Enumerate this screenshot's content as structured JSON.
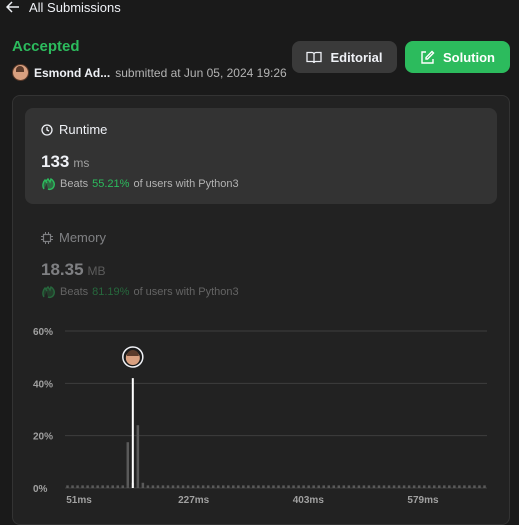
{
  "nav": {
    "back_label": "All Submissions"
  },
  "submission": {
    "status": "Accepted",
    "user": "Esmond Ad...",
    "submitted_text": "submitted at Jun 05, 2024 19:26"
  },
  "buttons": {
    "editorial": "Editorial",
    "solution": "Solution"
  },
  "runtime": {
    "title": "Runtime",
    "value": "133",
    "unit": "ms",
    "beats_label": "Beats",
    "beats_pct": "55.21%",
    "beats_suffix": "of users with Python3"
  },
  "memory": {
    "title": "Memory",
    "value": "18.35",
    "unit": "MB",
    "beats_label": "Beats",
    "beats_pct": "81.19%",
    "beats_suffix": "of users with Python3"
  },
  "colors": {
    "accent": "#2cbb5d",
    "background": "#1a1a1a",
    "panel": "#333333"
  },
  "chart_data": {
    "type": "bar",
    "x_ticks": [
      "51ms",
      "227ms",
      "403ms",
      "579ms"
    ],
    "y_ticks": [
      "0%",
      "20%",
      "40%",
      "60%"
    ],
    "ylim": [
      0,
      60
    ],
    "grid": true,
    "bars": [
      1,
      1,
      1,
      1,
      1,
      1,
      1,
      1,
      1,
      1,
      1,
      1,
      17.5,
      2,
      24,
      2,
      1,
      1,
      1,
      1,
      1,
      1,
      1,
      1,
      1,
      1,
      1,
      1,
      1,
      1,
      1,
      1,
      1,
      1,
      1,
      1,
      1,
      1,
      1,
      1,
      1,
      1,
      1,
      1,
      1,
      1,
      1,
      1,
      1,
      1,
      1,
      1,
      1,
      1,
      1,
      1,
      1,
      1,
      1,
      1,
      1,
      1,
      1,
      1,
      1,
      1,
      1,
      1,
      1,
      1,
      1,
      1,
      1,
      1,
      1,
      1,
      1,
      1,
      1,
      1,
      1,
      1,
      1,
      1
    ],
    "marker_index": 13,
    "marker_value": 42
  }
}
